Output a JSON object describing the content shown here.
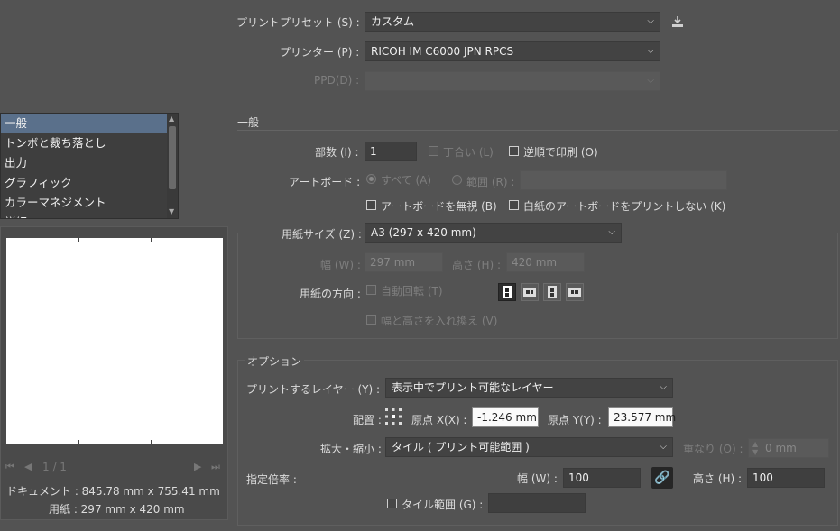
{
  "header": {
    "preset_label": "プリントプリセット (S) :",
    "preset_value": "カスタム",
    "printer_label": "プリンター (P) :",
    "printer_value": "RICOH IM C6000 JPN RPCS",
    "ppd_label": "PPD(D) :",
    "ppd_value": ""
  },
  "sidebar": {
    "items": [
      {
        "label": "一般"
      },
      {
        "label": "トンボと裁ち落とし"
      },
      {
        "label": "出力"
      },
      {
        "label": "グラフィック"
      },
      {
        "label": "カラーマネジメント"
      },
      {
        "label": "詳細"
      }
    ]
  },
  "preview": {
    "page_indicator": "1 / 1",
    "document_size": "ドキュメント : 845.78 mm x 755.41 mm",
    "paper_size": "用紙 : 297 mm x 420 mm"
  },
  "general": {
    "section_title": "一般",
    "copies_label": "部数 (I) :",
    "copies_value": "1",
    "collate_label": "丁合い (L)",
    "reverse_label": "逆順で印刷 (O)",
    "artboard_label": "アートボード :",
    "all_label": "すべて (A)",
    "range_label": "範囲 (R) :",
    "range_value": "",
    "ignore_artboards_label": "アートボードを無視 (B)",
    "skip_blank_label": "白紙のアートボードをプリントしない (K)"
  },
  "media": {
    "size_label": "用紙サイズ (Z) :",
    "size_value": "A3 (297 x 420 mm)",
    "width_label": "幅 (W) :",
    "width_value": "297 mm",
    "height_label": "高さ (H) :",
    "height_value": "420 mm",
    "orientation_label": "用紙の方向 :",
    "auto_rotate_label": "自動回転 (T)",
    "transverse_label": "幅と高さを入れ換え (V)"
  },
  "options": {
    "section_title": "オプション",
    "layers_label": "プリントするレイヤー (Y) :",
    "layers_value": "表示中でプリント可能なレイヤー",
    "placement_label": "配置 :",
    "origin_x_label": "原点 X(X) :",
    "origin_x_value": "-1.246 mm",
    "origin_y_label": "原点 Y(Y) :",
    "origin_y_value": "23.577 mm",
    "scaling_label": "拡大・縮小 :",
    "scaling_value": "タイル ( プリント可能範囲 )",
    "overlap_label": "重なり (O) :",
    "overlap_value": "0 mm",
    "custom_scale_label": "指定倍率 :",
    "scale_width_label": "幅 (W) :",
    "scale_width_value": "100",
    "scale_height_label": "高さ (H) :",
    "scale_height_value": "100",
    "tile_range_label": "タイル範囲 (G) :",
    "tile_range_value": ""
  },
  "colors": {
    "background": "#535353",
    "active_item": "#5a708b"
  }
}
